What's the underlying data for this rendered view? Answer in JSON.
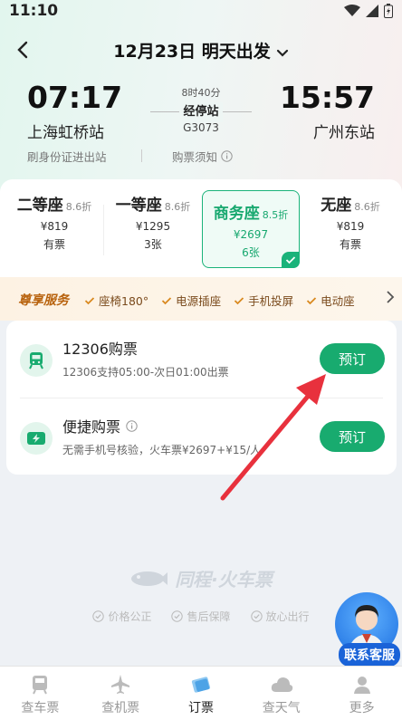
{
  "status": {
    "time": "11:10"
  },
  "header": {
    "date_title": "12月23日 明天出发"
  },
  "train": {
    "depart_time": "07:17",
    "arrive_time": "15:57",
    "depart_station": "上海虹桥站",
    "arrive_station": "广州东站",
    "duration": "8时40分",
    "stop_label": "经停站",
    "train_no": "G3073",
    "id_entry": "刷身份证进出站",
    "notice": "购票须知"
  },
  "seats": [
    {
      "name": "二等座",
      "discount": "8.6折",
      "price": "¥819",
      "avail": "有票"
    },
    {
      "name": "一等座",
      "discount": "8.6折",
      "price": "¥1295",
      "avail": "3张"
    },
    {
      "name": "商务座",
      "discount": "8.5折",
      "price": "¥2697",
      "avail": "6张"
    },
    {
      "name": "无座",
      "discount": "8.6折",
      "price": "¥819",
      "avail": "有票"
    }
  ],
  "service": {
    "title": "尊享服务",
    "items": [
      "座椅180°",
      "电源插座",
      "手机投屏",
      "电动座"
    ]
  },
  "booking": {
    "opt1": {
      "title": "12306购票",
      "desc": "12306支持05:00-次日01:00出票",
      "button": "预订"
    },
    "opt2": {
      "title": "便捷购票",
      "desc": "无需手机号核验，火车票¥2697+¥15/人",
      "button": "预订"
    }
  },
  "brand": {
    "name": "同程·火车票"
  },
  "guarantees": [
    "价格公正",
    "售后保障",
    "放心出行"
  ],
  "customer_service": {
    "label": "联系客服"
  },
  "nav": [
    {
      "label": "查车票"
    },
    {
      "label": "查机票"
    },
    {
      "label": "订票"
    },
    {
      "label": "查天气"
    },
    {
      "label": "更多"
    }
  ],
  "colors": {
    "accent": "#18ab6f",
    "service_title": "#b8620d",
    "arrow": "#e8313d"
  }
}
